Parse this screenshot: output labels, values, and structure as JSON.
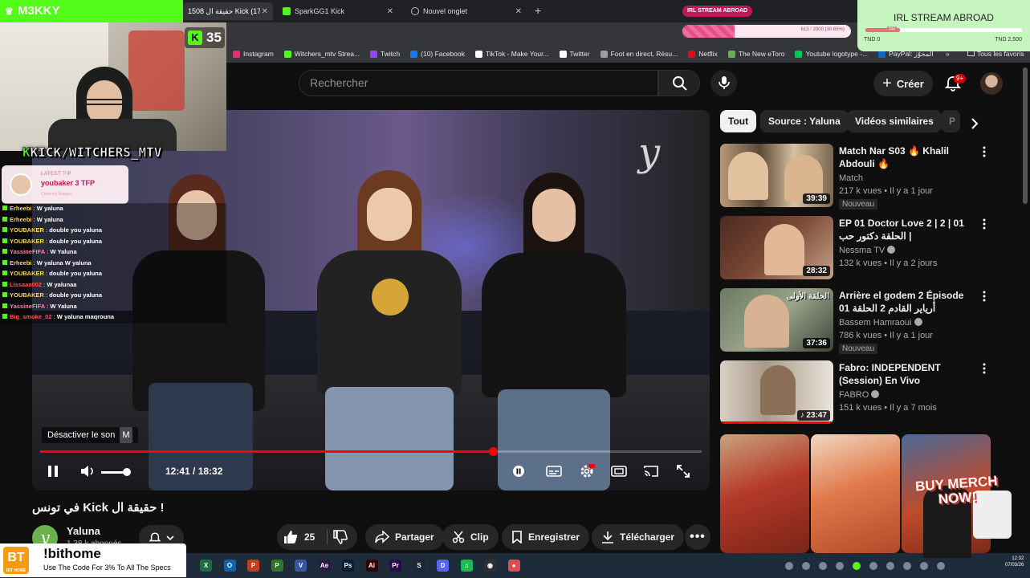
{
  "browser": {
    "tabs": [
      {
        "label": "1508  حقيقة ال Kick في (173)",
        "color": "#53fc18"
      },
      {
        "label": "SparkGG1 Kick",
        "color": "#53fc18"
      },
      {
        "label": "Nouvel onglet",
        "color": "#8ab4f8"
      }
    ],
    "irl_pill": "IRL STREAM ABROAD",
    "bookmarks": [
      {
        "label": "Instagram",
        "color": "#e1306c"
      },
      {
        "label": "Witchers_mtv Strea...",
        "color": "#53fc18"
      },
      {
        "label": "Twitch",
        "color": "#9146ff"
      },
      {
        "label": "(10) Facebook",
        "color": "#1877f2"
      },
      {
        "label": "TikTok - Make Your...",
        "color": "#ffffff"
      },
      {
        "label": "Twitter",
        "color": "#ffffff"
      },
      {
        "label": "Foot en direct, Résu...",
        "color": "#9e9e9e"
      },
      {
        "label": "Netflix",
        "color": "#e50914"
      },
      {
        "label": "The New eToro",
        "color": "#6ab04c"
      },
      {
        "label": "Youtube logotype -...",
        "color": "#00c853"
      },
      {
        "label": "PayPal: المحوّز",
        "color": "#1565c0"
      }
    ],
    "bookmarks_more": "»",
    "all_favorites": "Tous les favoris"
  },
  "stream": {
    "channel_overlay": "M3KKY",
    "viewer_count": "35",
    "kick_handle_prefix": "K",
    "kick_handle": "KICK/WITCHERS_MTV",
    "latest_tip_label": "LATEST TIP",
    "latest_tip": "youbaker 3 TFP",
    "latest_tip_sub": "Cheering Badges",
    "chat": [
      {
        "user": "Erheebi",
        "msg": "W yaluna",
        "color": "#ffd54f"
      },
      {
        "user": "Erheebi",
        "msg": "W yaluna",
        "color": "#ffd54f"
      },
      {
        "user": "YOUBAKER",
        "msg": "double you yaluna",
        "color": "#ffd54f"
      },
      {
        "user": "YOUBAKER",
        "msg": "double you yaluna",
        "color": "#ffd54f"
      },
      {
        "user": "YassineFIFA",
        "msg": "W Yaluna",
        "color": "#ff80ab"
      },
      {
        "user": "Erheebi",
        "msg": "W yaluna W yaluna",
        "color": "#ffd54f"
      },
      {
        "user": "YOUBAKER",
        "msg": "double you yaluna",
        "color": "#ffd54f"
      },
      {
        "user": "Lissaaa002",
        "msg": "W yalunaa",
        "color": "#ff5252"
      },
      {
        "user": "YOUBAKER",
        "msg": "double you yaluna",
        "color": "#ffd54f"
      },
      {
        "user": "YassineFIFA",
        "msg": "W Yaluna",
        "color": "#ff80ab"
      },
      {
        "user": "Big_smoke_02",
        "msg": "W yaluna maqrouna",
        "color": "#ff5252"
      }
    ],
    "irl_box_title": "IRL STREAM ABROAD",
    "irl_low": "TND 0",
    "irl_high": "TND 2,500",
    "irl_marker": "552",
    "irl_progress": 0.22,
    "goal_text": "613 / 2000 (30.65%)",
    "goal_progress": 0.31,
    "sponsor_brand": "BIT HOME",
    "sponsor_logo": "BT",
    "sponsor_command": "!bithome",
    "sponsor_sub": "Use The Code For 3% To All The Specs",
    "merch": "BUY MERCH NOW!"
  },
  "youtube": {
    "search_placeholder": "Rechercher",
    "create_label": "Créer",
    "notif_badge": "9+",
    "video": {
      "mute_tooltip": "Désactiver le son",
      "mute_key": "M",
      "time": "12:41 / 18:32",
      "progress": 0.685,
      "volume": 0.8,
      "logo": "y"
    },
    "title": "في تونس Kick حقيقة ال !",
    "channel_name": "Yaluna",
    "channel_subs": "1,38 k abonnés",
    "channel_avatar": "y",
    "like_count": "25",
    "actions": [
      "Partager",
      "Clip",
      "Enregistrer",
      "Télécharger"
    ],
    "chips": [
      "Tout",
      "Source : Yaluna",
      "Vidéos similaires",
      "P"
    ],
    "recommendations": [
      {
        "title": "Match Nar S03 🔥 Khalil Abdouli 🔥",
        "channel": "Match",
        "meta": "217 k vues • Il y a 1 jour",
        "duration": "39:39",
        "badge": "Nouveau",
        "thumb_color": "#7a6b55"
      },
      {
        "title": "EP 01 Doctor Love 2 | 2 | 01 الحلقة دكتور حب |",
        "channel": "Nessma TV",
        "meta": "132 k vues • Il y a 2 jours",
        "duration": "28:32",
        "badge": "",
        "thumb_color": "#5b3a2e"
      },
      {
        "title": "Arrière el godem 2 Épisode 01 أرياير القادم 2 الحلقة",
        "channel": "Bassem Hamraoui",
        "meta": "786 k vues • Il y a 1 jour",
        "duration": "37:36",
        "badge": "Nouveau",
        "thumb_color": "#6d7a63"
      },
      {
        "title": "Fabro: INDEPENDENT (Session) En Vivo",
        "channel": "FABRO",
        "meta": "151 k vues • Il y a 7 mois",
        "duration": "♪ 23:47",
        "badge": "",
        "thumb_color": "#b3a79a"
      }
    ],
    "thumb_overlays": [
      "الحلقة الأولى"
    ]
  }
}
